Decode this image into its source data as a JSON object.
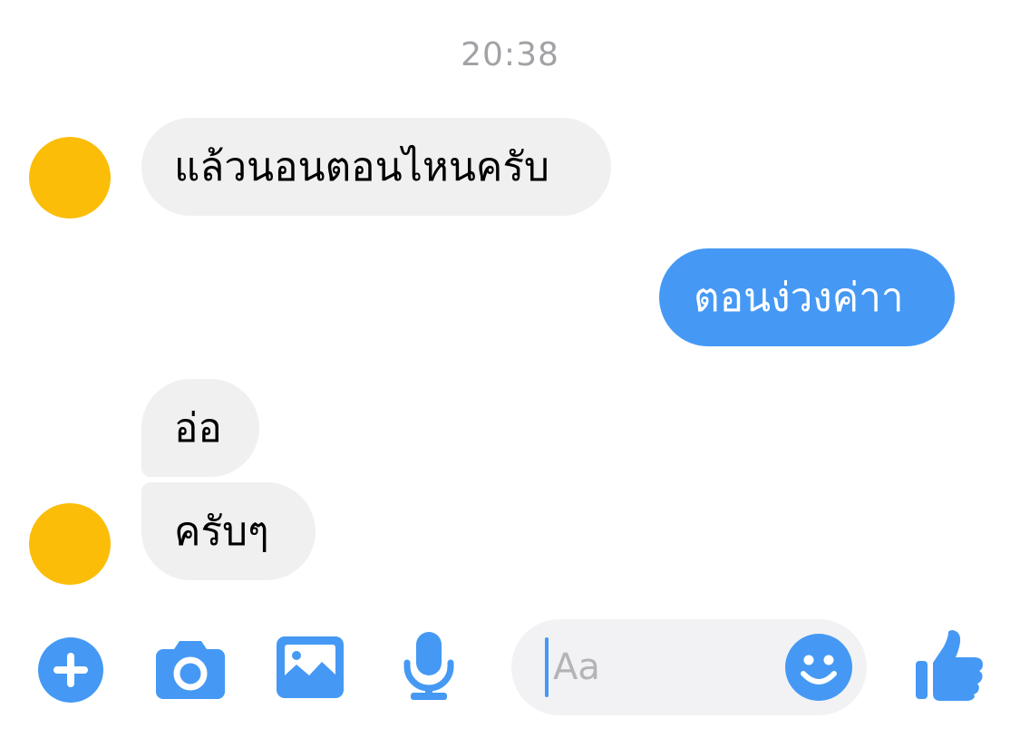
{
  "timestamp": "20:38",
  "messages": [
    {
      "from": "other",
      "text": "แล้วนอนตอนไหนครับ"
    },
    {
      "from": "me",
      "text": "ตอนง่วงค่าา"
    },
    {
      "from": "other",
      "text": "อ่อ"
    },
    {
      "from": "other",
      "text": "ครับๆ"
    }
  ],
  "composer": {
    "placeholder": "Aa",
    "icons": [
      "plus-icon",
      "camera-icon",
      "gallery-icon",
      "microphone-icon",
      "smiley-icon",
      "thumbs-up-icon"
    ]
  },
  "colors": {
    "accent": "#4599f4",
    "incoming_bubble": "#f0f0f0",
    "avatar": "#fbbd08",
    "timestamp": "#a2a2a6"
  }
}
